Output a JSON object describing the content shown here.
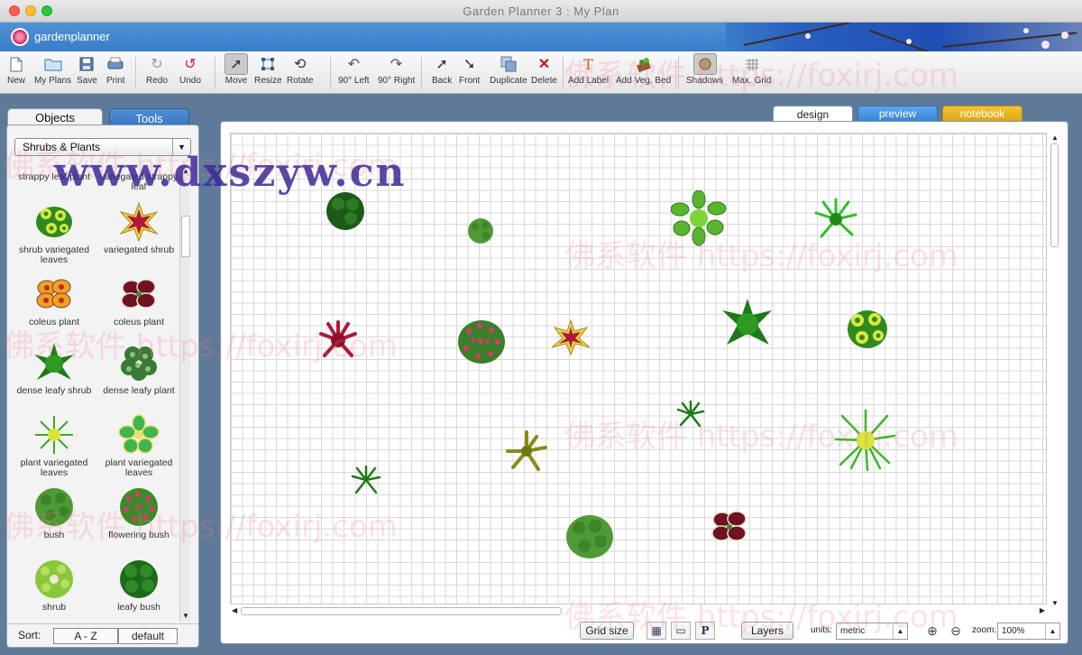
{
  "window": {
    "title": "Garden Planner 3 : My  Plan"
  },
  "brand": {
    "name": "gardenplanner"
  },
  "toolbar": {
    "new": "New",
    "my_plans": "My Plans",
    "save": "Save",
    "print": "Print",
    "redo": "Redo",
    "undo": "Undo",
    "move": "Move",
    "resize": "Resize",
    "rotate": "Rotate",
    "rot_left": "90° Left",
    "rot_right": "90° Right",
    "back": "Back",
    "front": "Front",
    "duplicate": "Duplicate",
    "delete": "Delete",
    "add_label": "Add Label",
    "add_veg_bed": "Add Veg. Bed",
    "shadows": "Shadows",
    "max_grid": "Max. Grid"
  },
  "left_panel": {
    "tabs": {
      "objects": "Objects",
      "tools": "Tools"
    },
    "category": "Shrubs & Plants",
    "items": [
      {
        "label": "strappy leaf plant",
        "icon": "strappy-leaf-plant-icon"
      },
      {
        "label": "variegated strappy leaf",
        "icon": "variegated-strappy-leaf-icon"
      },
      {
        "label": "shrub variegated leaves",
        "icon": "shrub-variegated-leaves-icon"
      },
      {
        "label": "variegated shrub",
        "icon": "variegated-shrub-icon"
      },
      {
        "label": "coleus plant",
        "icon": "coleus-plant-icon"
      },
      {
        "label": "coleus plant",
        "icon": "coleus-plant-dark-icon"
      },
      {
        "label": "dense leafy shrub",
        "icon": "dense-leafy-shrub-icon"
      },
      {
        "label": "dense leafy plant",
        "icon": "dense-leafy-plant-icon"
      },
      {
        "label": "plant variegated leaves",
        "icon": "plant-variegated-leaves-icon"
      },
      {
        "label": "plant variegated leaves",
        "icon": "plant-variegated-leaves-2-icon"
      },
      {
        "label": "bush",
        "icon": "bush-icon"
      },
      {
        "label": "flowering bush",
        "icon": "flowering-bush-icon"
      },
      {
        "label": "shrub",
        "icon": "shrub-icon"
      },
      {
        "label": "leafy bush",
        "icon": "leafy-bush-icon"
      }
    ],
    "sort": {
      "label": "Sort:",
      "az": "A - Z",
      "default": "default"
    }
  },
  "view_tabs": {
    "design": "design",
    "preview": "preview",
    "notebook": "notebook"
  },
  "bottom": {
    "grid_size": "Grid size",
    "p_button": "P",
    "layers": "Layers",
    "units_label": "units:",
    "units_value": "metric",
    "zoom_label": "zoom:",
    "zoom_value": "100%"
  },
  "colors": {
    "accent": "#3a7dc8",
    "notebook": "#e9b322",
    "preview": "#4a97e3"
  },
  "watermarks": {
    "foxirj": "佛系软件 https://foxirj.com",
    "dxszyw": "www.dxszyw.cn"
  }
}
